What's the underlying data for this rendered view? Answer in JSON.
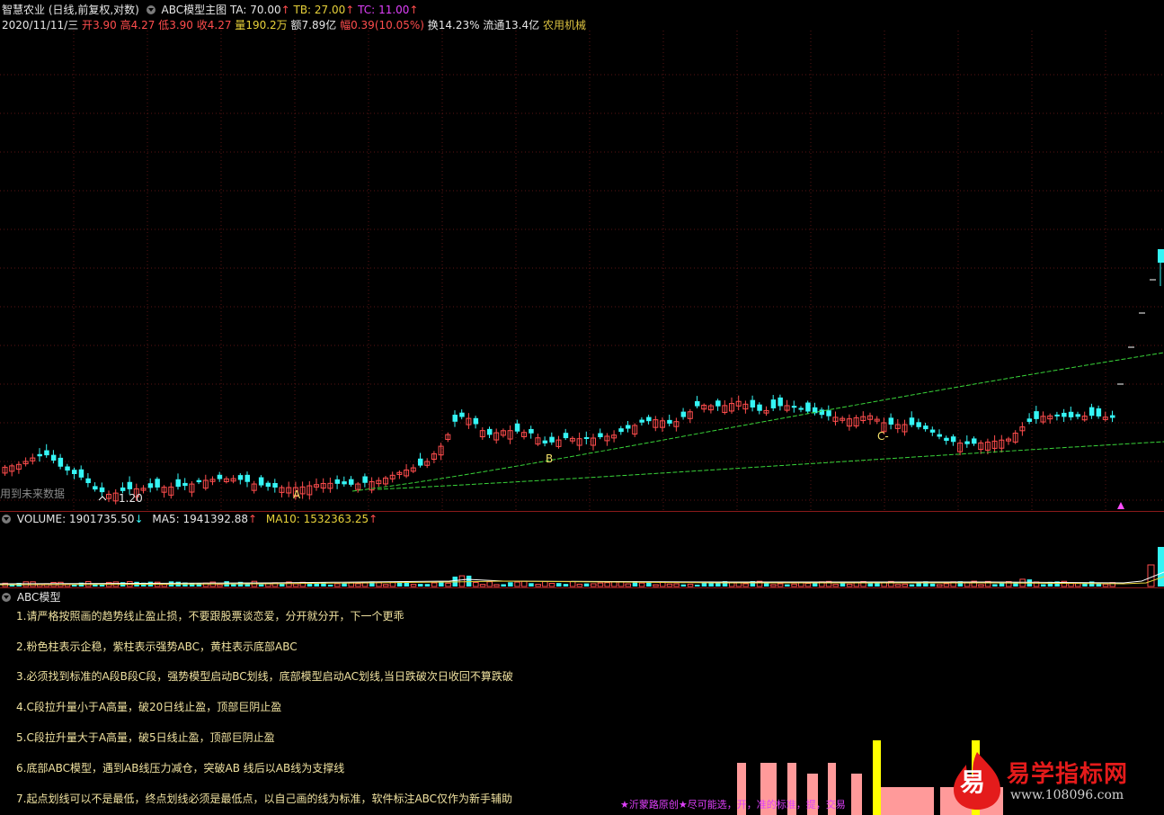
{
  "header": {
    "stock_name": "智慧农业",
    "period": "(日线,前复权,对数)",
    "indicator": "ABC模型主图",
    "ta_label": "TA:",
    "ta_value": "70.00",
    "ta_arrow": "↑",
    "tb_label": "TB:",
    "tb_value": "27.00",
    "tb_arrow": "↑",
    "tc_label": "TC:",
    "tc_value": "11.00",
    "tc_arrow": "↑"
  },
  "quote": {
    "date": "2020/11/11/三",
    "open_label": "开",
    "open": "3.90",
    "high_label": "高",
    "high": "4.27",
    "low_label": "低",
    "low": "3.90",
    "close_label": "收",
    "close": "4.27",
    "vol_label": "量",
    "vol": "190.2万",
    "amount_label": "额",
    "amount": "7.89亿",
    "change_label": "幅",
    "change": "0.39(10.05%)",
    "turnover_label": "换",
    "turnover": "14.23%",
    "float_label": "流通",
    "float": "13.4亿",
    "sector": "农用机械"
  },
  "main_chart": {
    "future_data_note": "用到未来数据",
    "label_low": "1.20",
    "label_a": "A",
    "label_b": "B",
    "label_c": "C-"
  },
  "volume": {
    "label": "VOLUME:",
    "value": "1901735.50",
    "arrow": "↓",
    "ma5_label": "MA5:",
    "ma5_value": "1941392.88",
    "ma5_arrow": "↑",
    "ma10_label": "MA10:",
    "ma10_value": "1532363.25",
    "ma10_arrow": "↑"
  },
  "abc_panel": {
    "title": "ABC模型",
    "notes": [
      "1.请严格按照画的趋势线止盈止损，不要跟股票谈恋爱，分开就分开，下一个更乖",
      "2.粉色柱表示企稳，紫柱表示强势ABC，黄柱表示底部ABC",
      "3.必须找到标准的A段B段C段，强势模型启动BC划线，底部模型启动AC划线,当日跌破次日收回不算跌破",
      "4.C段拉升量小于A高量，破20日线止盈，顶部巨阴止盈",
      "5.C段拉升量大于A高量，破5日线止盈，顶部巨阴止盈",
      "6.底部ABC模型，遇到AB线压力减仓，突破AB 线后以AB线为支撑线",
      "7.起点划线可以不是最低，终点划线必须是最低点，以自己画的线为标准，软件标注ABC仅作为新手辅助"
    ],
    "footer_text": "★沂蒙路原创★尽可能选，开，准的标准，提，交易"
  },
  "logo": {
    "char": "易",
    "name": "易学指标网",
    "url": "www.108096.com"
  },
  "colors": {
    "up": "#ff4d4d",
    "down": "#35f5f5",
    "trend": "#39d439",
    "pink": "#ff9a9a",
    "yellow": "#ffff00"
  }
}
